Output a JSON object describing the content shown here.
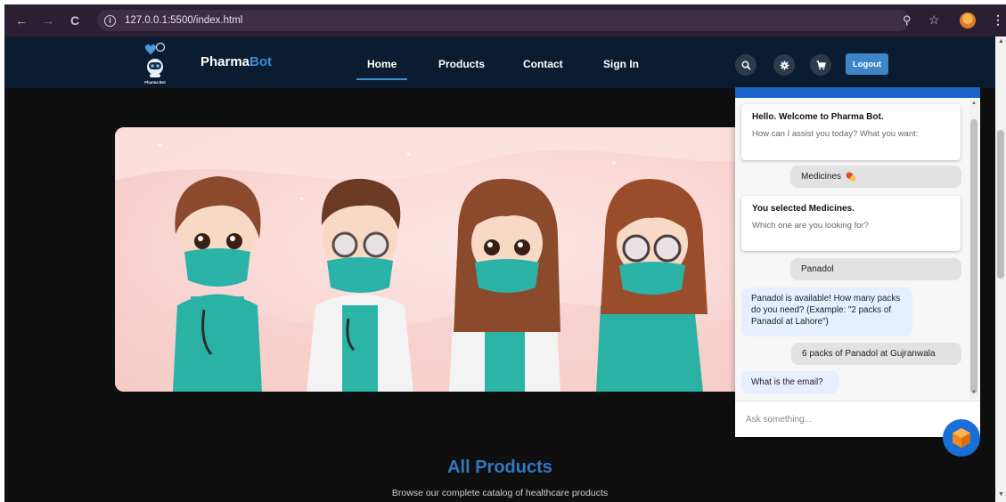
{
  "browser": {
    "url": "127.0.0.1:5500/index.html",
    "icons": [
      "back-icon",
      "forward-icon",
      "reload-icon",
      "info-icon",
      "zoom-icon",
      "bookmark-star-icon",
      "profile-avatar",
      "menu-icon"
    ]
  },
  "header": {
    "logo_text": "Pharma Bot",
    "brand_primary": "Pharma",
    "brand_accent": "Bot",
    "nav": [
      "Home",
      "Products",
      "Contact",
      "Sign In"
    ],
    "active_nav": "Home",
    "icons": [
      "search-icon",
      "settings-icon",
      "cart-icon"
    ],
    "logout_label": "Logout",
    "colors": {
      "header_bg": "#0c1c30",
      "accent": "#3a8fd6",
      "logout_bg": "#3d84c9"
    }
  },
  "hero": {
    "illustration": "four cartoon medical staff wearing teal face masks and scrubs"
  },
  "products": {
    "title": "All Products",
    "subtitle": "Browse our complete catalog of healthcare products"
  },
  "chat": {
    "messages": [
      {
        "from": "bot",
        "bold": "Hello. Welcome to Pharma Bot.",
        "light": "How can I assist you today? What you want:"
      },
      {
        "from": "user",
        "text": "Medicines",
        "icon": "pill-icon"
      },
      {
        "from": "bot",
        "bold": "You selected Medicines.",
        "light": "Which one are you looking for?"
      },
      {
        "from": "user",
        "text": "Panadol"
      },
      {
        "from": "bot",
        "text": "Panadol is available! How many packs do you need? (Example: \"2 packs of Panadol at Lahore\")"
      },
      {
        "from": "user",
        "text": "6 packs of Panadol at Gujranwala"
      },
      {
        "from": "bot",
        "text": "What is the email?"
      }
    ],
    "input_placeholder": "Ask something...",
    "colors": {
      "header": "#1b63c6",
      "bot_bubble": "#e5efff",
      "user_pill": "#e2e2e2"
    }
  }
}
